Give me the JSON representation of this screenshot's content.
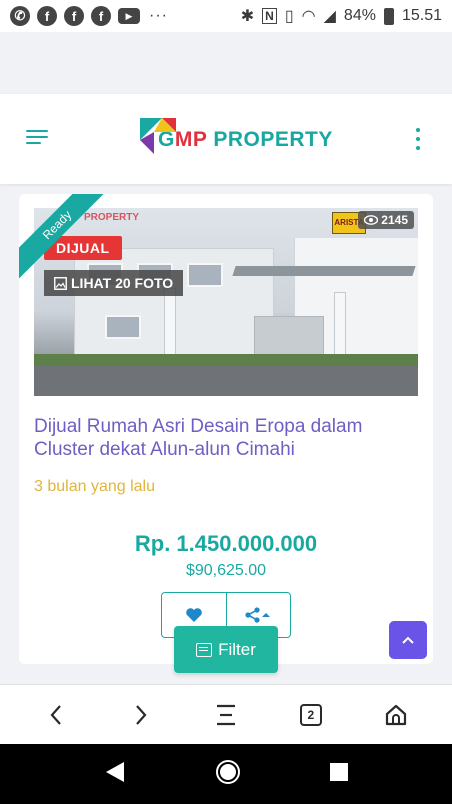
{
  "status_bar": {
    "battery": "84%",
    "time": "15.51",
    "more": "···",
    "icons": [
      "whatsapp-icon",
      "facebook-icon",
      "facebook-icon",
      "facebook-icon",
      "youtube-icon",
      "bluetooth-icon",
      "nfc-icon",
      "vibrate-icon",
      "wifi-icon",
      "signal-icon",
      "battery-icon"
    ]
  },
  "header": {
    "logo_g": "G",
    "logo_m": "M",
    "logo_p": "P",
    "logo_rest": " PROPERTY"
  },
  "listing": {
    "ribbon": "Ready",
    "status_badge": "DIJUAL",
    "photos_button": "LIHAT 20 FOTO",
    "views": "2145",
    "watermark": "PROPERTY",
    "brand_badge": "ARISTA",
    "title": "Dijual Rumah Asri Desain Eropa dalam Cluster dekat Alun-alun Cimahi",
    "date": "3 bulan yang lalu",
    "price": "Rp. 1.450.000.000",
    "price_usd": "$90,625.00"
  },
  "filter": {
    "label": "Filter"
  },
  "colors": {
    "accent": "#1aa9a2",
    "title": "#6d5fc4",
    "date": "#e2b43a",
    "badge_red": "#e53535",
    "scroll_top": "#6a54e8"
  },
  "browser_bar": {
    "tab_count": "2"
  }
}
